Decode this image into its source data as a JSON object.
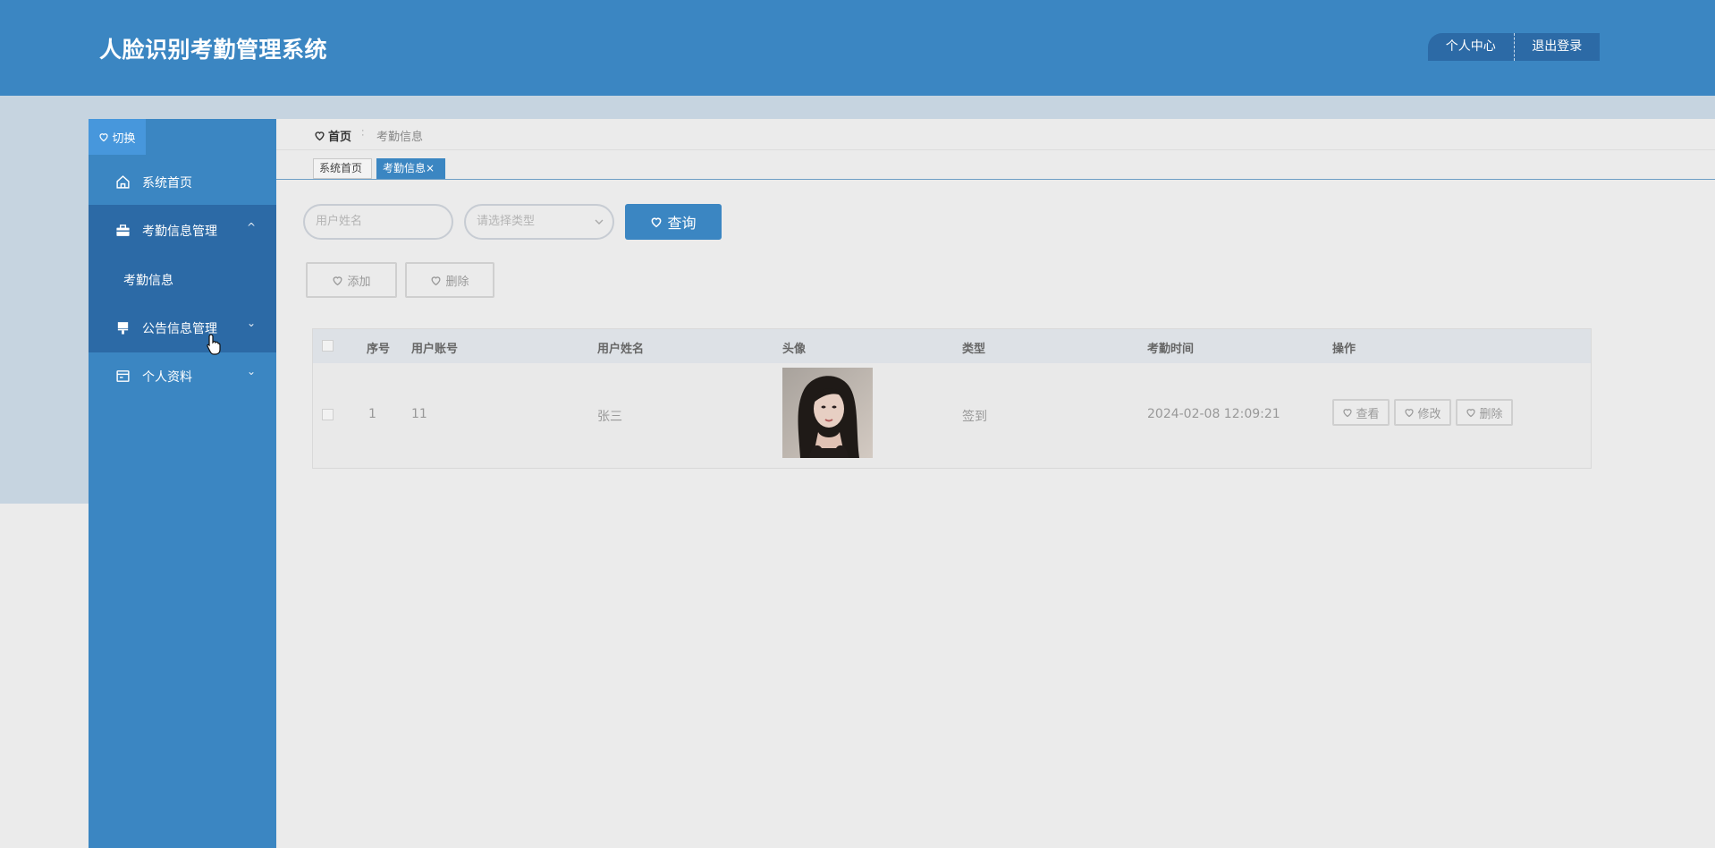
{
  "header": {
    "title": "人脸识别考勤管理系统",
    "personal_center": "个人中心",
    "logout": "退出登录"
  },
  "sidebar": {
    "toggle_label": "切换",
    "items": [
      {
        "label": "系统首页",
        "icon": "home-icon"
      },
      {
        "label": "考勤信息管理",
        "icon": "briefcase-icon",
        "arrow": "^",
        "expanded": true
      },
      {
        "label": "考勤信息",
        "icon": ""
      },
      {
        "label": "公告信息管理",
        "icon": "announcement-icon",
        "arrow": "⌄"
      },
      {
        "label": "个人资料",
        "icon": "profile-card-icon",
        "arrow": "⌄"
      }
    ]
  },
  "breadcrumb": {
    "home": "首页",
    "separator": "∶",
    "current": "考勤信息"
  },
  "tabs": [
    {
      "label": "系统首页"
    },
    {
      "label": "考勤信息",
      "close": "×",
      "active": true
    }
  ],
  "search": {
    "name_placeholder": "用户姓名",
    "type_placeholder": "请选择类型",
    "query_label": "查询"
  },
  "actions": {
    "add_label": "添加",
    "delete_label": "删除"
  },
  "table": {
    "columns": [
      "序号",
      "用户账号",
      "用户姓名",
      "头像",
      "类型",
      "考勤时间",
      "操作"
    ],
    "rows": [
      {
        "index": "1",
        "account": "11",
        "name": "张三",
        "type": "签到",
        "time": "2024-02-08 12:09:21",
        "ops": [
          "查看",
          "修改",
          "删除"
        ]
      }
    ]
  },
  "colors": {
    "primary": "#3b86c2",
    "primary_dark": "#2c6aa6",
    "background": "#ebebeb"
  }
}
